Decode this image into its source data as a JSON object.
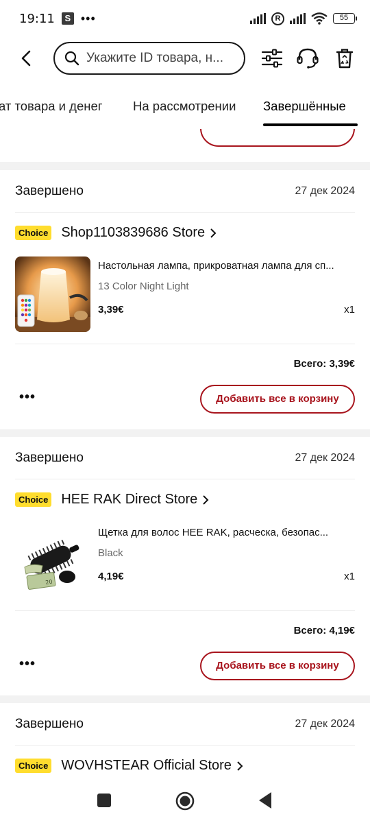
{
  "status_bar": {
    "time": "19:11",
    "app_badge": "S",
    "dots": "•••",
    "battery": "55"
  },
  "search": {
    "placeholder": "Укажите ID товара, н..."
  },
  "tabs": [
    {
      "label": "ат товара и денег"
    },
    {
      "label": "На рассмотрении"
    },
    {
      "label": "Завершённые",
      "active": true
    }
  ],
  "orders": [
    {
      "status": "Завершено",
      "date": "27 дек 2024",
      "badge": "Choice",
      "store": "Shop1103839686 Store",
      "product_title": "Настольная лампа, прикроватная лампа для сп...",
      "variant": "13 Color Night Light",
      "price": "3,39€",
      "qty": "x1",
      "total": "Всего: 3,39€",
      "more": "•••",
      "button": "Добавить все в корзину",
      "image": "night-lamp-image"
    },
    {
      "status": "Завершено",
      "date": "27 дек 2024",
      "badge": "Choice",
      "store": "HEE RAK Direct Store",
      "product_title": "Щетка для волос HEE RAK, расческа, безопас...",
      "variant": "Black",
      "price": "4,19€",
      "qty": "x1",
      "total": "Всего: 4,19€",
      "more": "•••",
      "button": "Добавить все в корзину",
      "image": "hairbrush-stash-image"
    },
    {
      "status": "Завершено",
      "date": "27 дек 2024",
      "badge": "Choice",
      "store": "WOVHSTEAR Official Store"
    }
  ],
  "colors": {
    "accent": "#a8141d",
    "choice_badge": "#ffdd2e",
    "background": "#f2f2f2"
  },
  "icons": [
    "back-arrow-icon",
    "search-icon",
    "filter-sliders-icon",
    "support-headset-icon",
    "trash-icon",
    "chevron-right-icon",
    "nav-recents-icon",
    "nav-home-icon",
    "nav-back-icon"
  ]
}
